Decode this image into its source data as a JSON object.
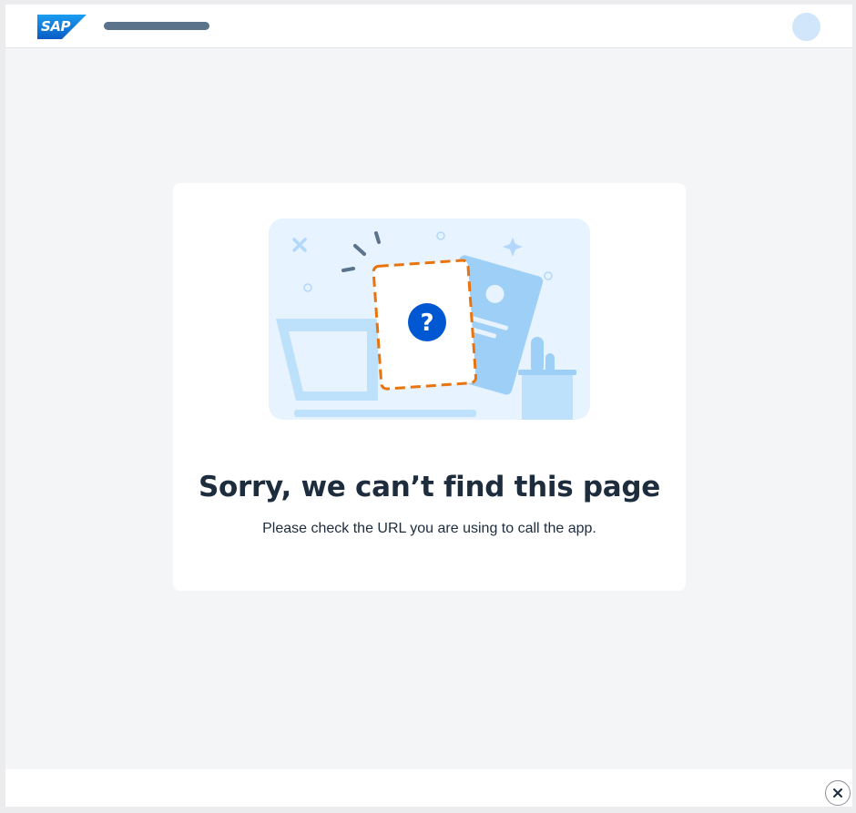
{
  "header": {
    "logo_text": "SAP",
    "icons": {
      "logo": "sap-logo",
      "avatar": "user-avatar-placeholder"
    }
  },
  "message": {
    "title": "Sorry, we can’t find this page",
    "description": "Please check the URL you are using to call the app.",
    "illustration_icon": "page-not-found-illustration"
  },
  "footer": {
    "close_icon": "close-icon"
  },
  "colors": {
    "accent": "#0057d2",
    "brand_blue": "#0070f2",
    "warning_orange": "#e9730c",
    "title_text": "#1d2d3e",
    "page_background": "#f4f5f7"
  }
}
